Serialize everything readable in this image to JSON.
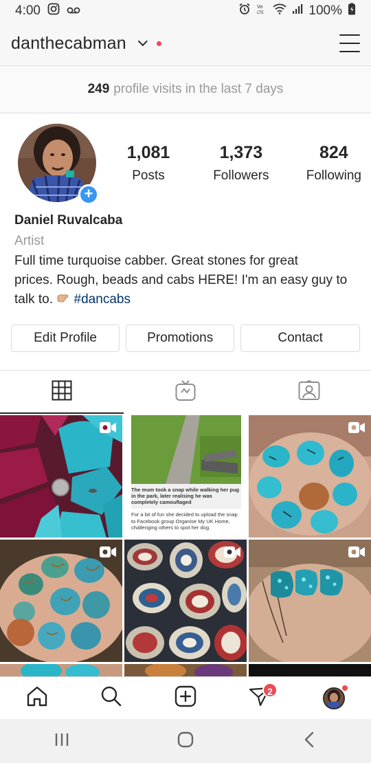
{
  "status_bar": {
    "time": "4:00",
    "battery": "100%",
    "left_icons": [
      "instagram-icon",
      "voicemail-icon"
    ],
    "right_icons": [
      "alarm-icon",
      "volte-icon",
      "wifi-icon",
      "signal-icon",
      "battery-icon"
    ]
  },
  "header": {
    "username": "danthecabman",
    "menu_icon": "hamburger-icon"
  },
  "visits": {
    "count": "249",
    "text": "profile visits in the last 7 days"
  },
  "profile": {
    "stats": [
      {
        "value": "1,081",
        "label": "Posts"
      },
      {
        "value": "1,373",
        "label": "Followers"
      },
      {
        "value": "824",
        "label": "Following"
      }
    ],
    "name": "Daniel Ruvalcaba",
    "category": "Artist",
    "bio_line1": "Full time turquoise cabber. Great stones for great",
    "bio_line2": "prices. Rough, beads and cabs HERE! I'm an easy guy to",
    "bio_line3_prefix": "talk to.",
    "hashtag": "#dancabs"
  },
  "actions": {
    "edit_profile": "Edit Profile",
    "promotions": "Promotions",
    "contact": "Contact"
  },
  "tabs": [
    {
      "icon": "grid-icon",
      "active": true
    },
    {
      "icon": "igtv-icon",
      "active": false
    },
    {
      "icon": "tagged-icon",
      "active": false
    }
  ],
  "grid": {
    "news_headline": "The mum took a snap while walking her pug in the park, later realising he was completely camouflaged",
    "news_body": "For a bit of fun she decided to upload the snap to Facebook group Organise My UK Home, challenging others to spot her dog."
  },
  "bottom_nav": {
    "icons": [
      "home-icon",
      "search-icon",
      "new-post-icon",
      "direct-icon",
      "profile-avatar"
    ],
    "direct_badge": "2"
  },
  "colors": {
    "accent_blue": "#3897f0",
    "notification_red": "#ed4956",
    "hashtag": "#003569",
    "turquoise": "#2bb5c8",
    "magenta_stone": "#8a1640"
  }
}
